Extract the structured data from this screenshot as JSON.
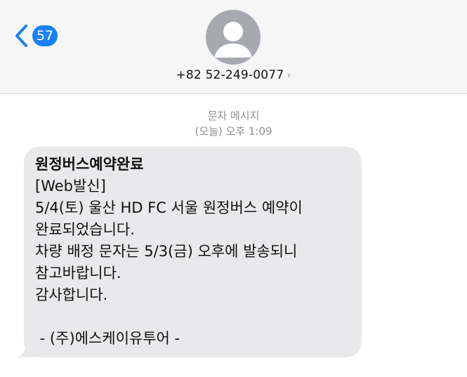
{
  "nav": {
    "unread_count": "57"
  },
  "contact": {
    "phone": "+82 52-249-0077",
    "chevron": "›"
  },
  "conversation": {
    "service_label": "문자 메시지",
    "timestamp": "(오늘) 오후 1:09"
  },
  "message": {
    "lines": [
      "원정버스예약완료",
      "[Web발신]",
      "5/4(토) 울산 HD FC 서울 원정버스 예약이",
      "완료되었습니다.",
      "차량 배정 문자는 5/3(금) 오후에 발송되니",
      "참고바랍니다.",
      "감사합니다.",
      "",
      " - (주)에스케이유투어 -"
    ]
  },
  "colors": {
    "accent": "#1a82f7",
    "bubble": "#e9e9eb",
    "header_bg": "#f6f6f7",
    "meta_text": "#8e8e93",
    "avatar_bg": "#a6a9b0"
  },
  "icons": {
    "back": "chevron-left-icon",
    "avatar": "person-icon",
    "contact_detail": "chevron-right-icon"
  }
}
